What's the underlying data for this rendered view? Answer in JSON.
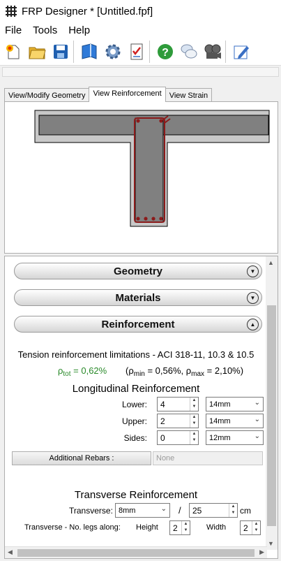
{
  "window": {
    "title": "FRP Designer * [Untitled.fpf]"
  },
  "menu": [
    "File",
    "Tools",
    "Help"
  ],
  "toolbar": {
    "icons": [
      "new-icon",
      "open-icon",
      "save-icon",
      "manual-icon",
      "settings-icon",
      "check-icon",
      "help-icon",
      "chat-icon",
      "film-icon",
      "edit-icon"
    ]
  },
  "tabs": [
    {
      "label": "View/Modify Geometry",
      "active": false
    },
    {
      "label": "View Reinforcement",
      "active": true
    },
    {
      "label": "View Strain",
      "active": false
    }
  ],
  "sections": {
    "geometry": "Geometry",
    "materials": "Materials",
    "reinforcement": "Reinforcement"
  },
  "limits": {
    "text": "Tension reinforcement limitations - ACI 318-11, 10.3 & 10.5",
    "rho_tot_label": "ρ",
    "rho_tot_sub": "tot",
    "rho_tot_value": " = 0,62%",
    "range_open": "(ρ",
    "rho_min_sub": "min",
    "rho_min_value": " = 0,56%, ρ",
    "rho_max_sub": "max",
    "rho_max_value": " = 2,10%)"
  },
  "longitudinal": {
    "heading": "Longitudinal Reinforcement",
    "rows": [
      {
        "label": "Lower:",
        "count": "4",
        "diameter": "14mm"
      },
      {
        "label": "Upper:",
        "count": "2",
        "diameter": "14mm"
      },
      {
        "label": "Sides:",
        "count": "0",
        "diameter": "12mm"
      }
    ],
    "additional_button": "Additional Rebars :",
    "additional_value": "None"
  },
  "transverse": {
    "heading": "Transverse Reinforcement",
    "label": "Transverse:",
    "diameter": "8mm",
    "slash": "/",
    "spacing": "25",
    "unit": "cm",
    "legs_label": "Transverse - No. legs along:",
    "height_label": "Height",
    "height_value": "2",
    "width_label": "Width",
    "width_value": "2"
  },
  "colors": {
    "accent_green": "#2a8a2a",
    "concrete": "#808080",
    "rebar": "#8b1a1a"
  }
}
